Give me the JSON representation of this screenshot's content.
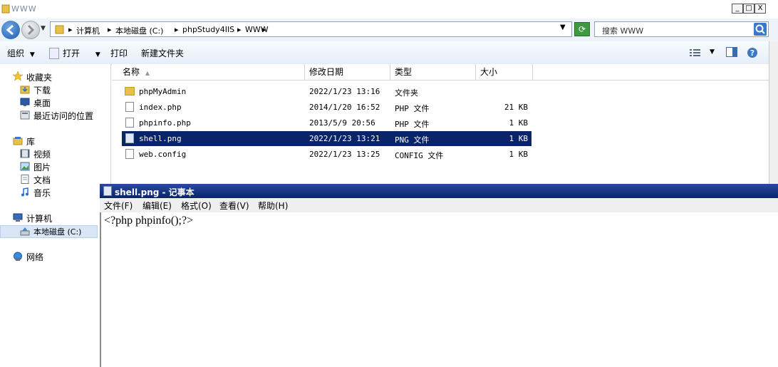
{
  "window": {
    "title": "WWW"
  },
  "window_buttons": {
    "minimize": "_",
    "maximize": "□",
    "close": "X"
  },
  "address": {
    "crumbs": [
      "计算机",
      "本地磁盘 (C:)",
      "phpStudy4IIS",
      "WWW"
    ],
    "separator": "▸"
  },
  "search": {
    "placeholder": "搜索 WWW"
  },
  "toolbar": {
    "organize": "组织",
    "open": "打开",
    "print": "打印",
    "new_folder": "新建文件夹",
    "dropdown": "▼"
  },
  "nav": {
    "favorites": "收藏夹",
    "downloads": "下载",
    "desktop": "桌面",
    "recent": "最近访问的位置",
    "libraries": "库",
    "videos": "视频",
    "pictures": "图片",
    "documents": "文档",
    "music": "音乐",
    "computer": "计算机",
    "local_disk": "本地磁盘 (C:)",
    "network": "网络"
  },
  "columns": {
    "name": "名称",
    "modified": "修改日期",
    "type": "类型",
    "size": "大小"
  },
  "files": [
    {
      "name": "phpMyAdmin",
      "modified": "2022/1/23 13:16",
      "type": "文件夹",
      "size": ""
    },
    {
      "name": "index.php",
      "modified": "2014/1/20 16:52",
      "type": "PHP 文件",
      "size": "21 KB"
    },
    {
      "name": "phpinfo.php",
      "modified": "2013/5/9 20:56",
      "type": "PHP 文件",
      "size": "1 KB"
    },
    {
      "name": "shell.png",
      "modified": "2022/1/23 13:21",
      "type": "PNG 文件",
      "size": "1 KB"
    },
    {
      "name": "web.config",
      "modified": "2022/1/23 13:25",
      "type": "CONFIG 文件",
      "size": "1 KB"
    }
  ],
  "notepad": {
    "title": "shell.png - 记事本",
    "menu": [
      "文件(F)",
      "编辑(E)",
      "格式(O)",
      "查看(V)",
      "帮助(H)"
    ],
    "content": "<?php phpinfo();?>"
  }
}
